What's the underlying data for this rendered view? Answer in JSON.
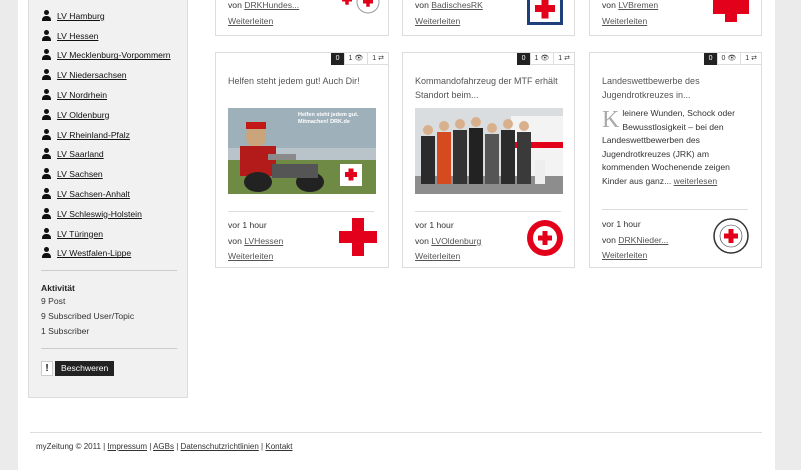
{
  "sidebar": {
    "items": [
      {
        "label": "LV Hamburg"
      },
      {
        "label": "LV Hessen"
      },
      {
        "label": "LV Mecklenburg-Vorpommern"
      },
      {
        "label": "LV Niedersachsen"
      },
      {
        "label": "LV Nordrhein"
      },
      {
        "label": "LV Oldenburg"
      },
      {
        "label": "LV Rheinland-Pfalz"
      },
      {
        "label": "LV Saarland"
      },
      {
        "label": "LV Sachsen"
      },
      {
        "label": "LV Sachsen-Anhalt"
      },
      {
        "label": "LV Schleswig-Holstein"
      },
      {
        "label": "LV Türingen"
      },
      {
        "label": "LV Westfalen-Lippe"
      }
    ],
    "activity": {
      "title": "Aktivität",
      "posts": "9 Post",
      "subscribed": "9 Subscribed User/Topic",
      "subscriber": "1 Subscriber"
    },
    "complain": {
      "icon": "!",
      "label": "Beschweren"
    }
  },
  "top_cards": [
    {
      "von": "von",
      "source": "DRKHundes...",
      "weiter": "Weiterleiten"
    },
    {
      "von": "von",
      "source": "BadischesRK",
      "weiter": "Weiterleiten"
    },
    {
      "von": "von",
      "source": "LVBremen",
      "weiter": "Weiterleiten"
    }
  ],
  "cards": [
    {
      "stats": {
        "comments": "0",
        "views": "1",
        "shares": "1"
      },
      "title": "Helfen steht jedem gut! Auch Dir!",
      "image_caption": "Helfen steht jedem gut. Mitmachen! DRK.de",
      "time": "vor 1 hour",
      "von": "von",
      "source": "LVHessen",
      "weiter": "Weiterleiten"
    },
    {
      "stats": {
        "comments": "0",
        "views": "1",
        "shares": "1"
      },
      "title": "Kommandofahrzeug der MTF erhält Standort beim...",
      "time": "vor 1 hour",
      "von": "von",
      "source": "LVOldenburg",
      "weiter": "Weiterleiten"
    },
    {
      "stats": {
        "comments": "0",
        "views": "0",
        "shares": "1"
      },
      "title": "Landeswettbewerbe des Jugendrotkreuzes in...",
      "dropcap": "K",
      "excerpt": "leinere Wunden, Schock oder Bewusstlosigkeit – bei den Landeswettbewerben des Jugendrotkreuzes (JRK) am kommenden Wochenende zeigen Kinder aus ganz...",
      "readmore": "weiterlesen",
      "time": "vor 1 hour",
      "von": "von",
      "source": "DRKNieder...",
      "weiter": "Weiterleiten"
    }
  ],
  "footer": {
    "copyright": "myZeitung © 2011 |",
    "links": [
      "Impressum",
      "AGBs",
      "Datenschutzrichtlinien",
      "Kontakt"
    ],
    "sep": "|"
  },
  "colors": {
    "red_cross": "#e2001a",
    "dark_badge": "#222222"
  }
}
